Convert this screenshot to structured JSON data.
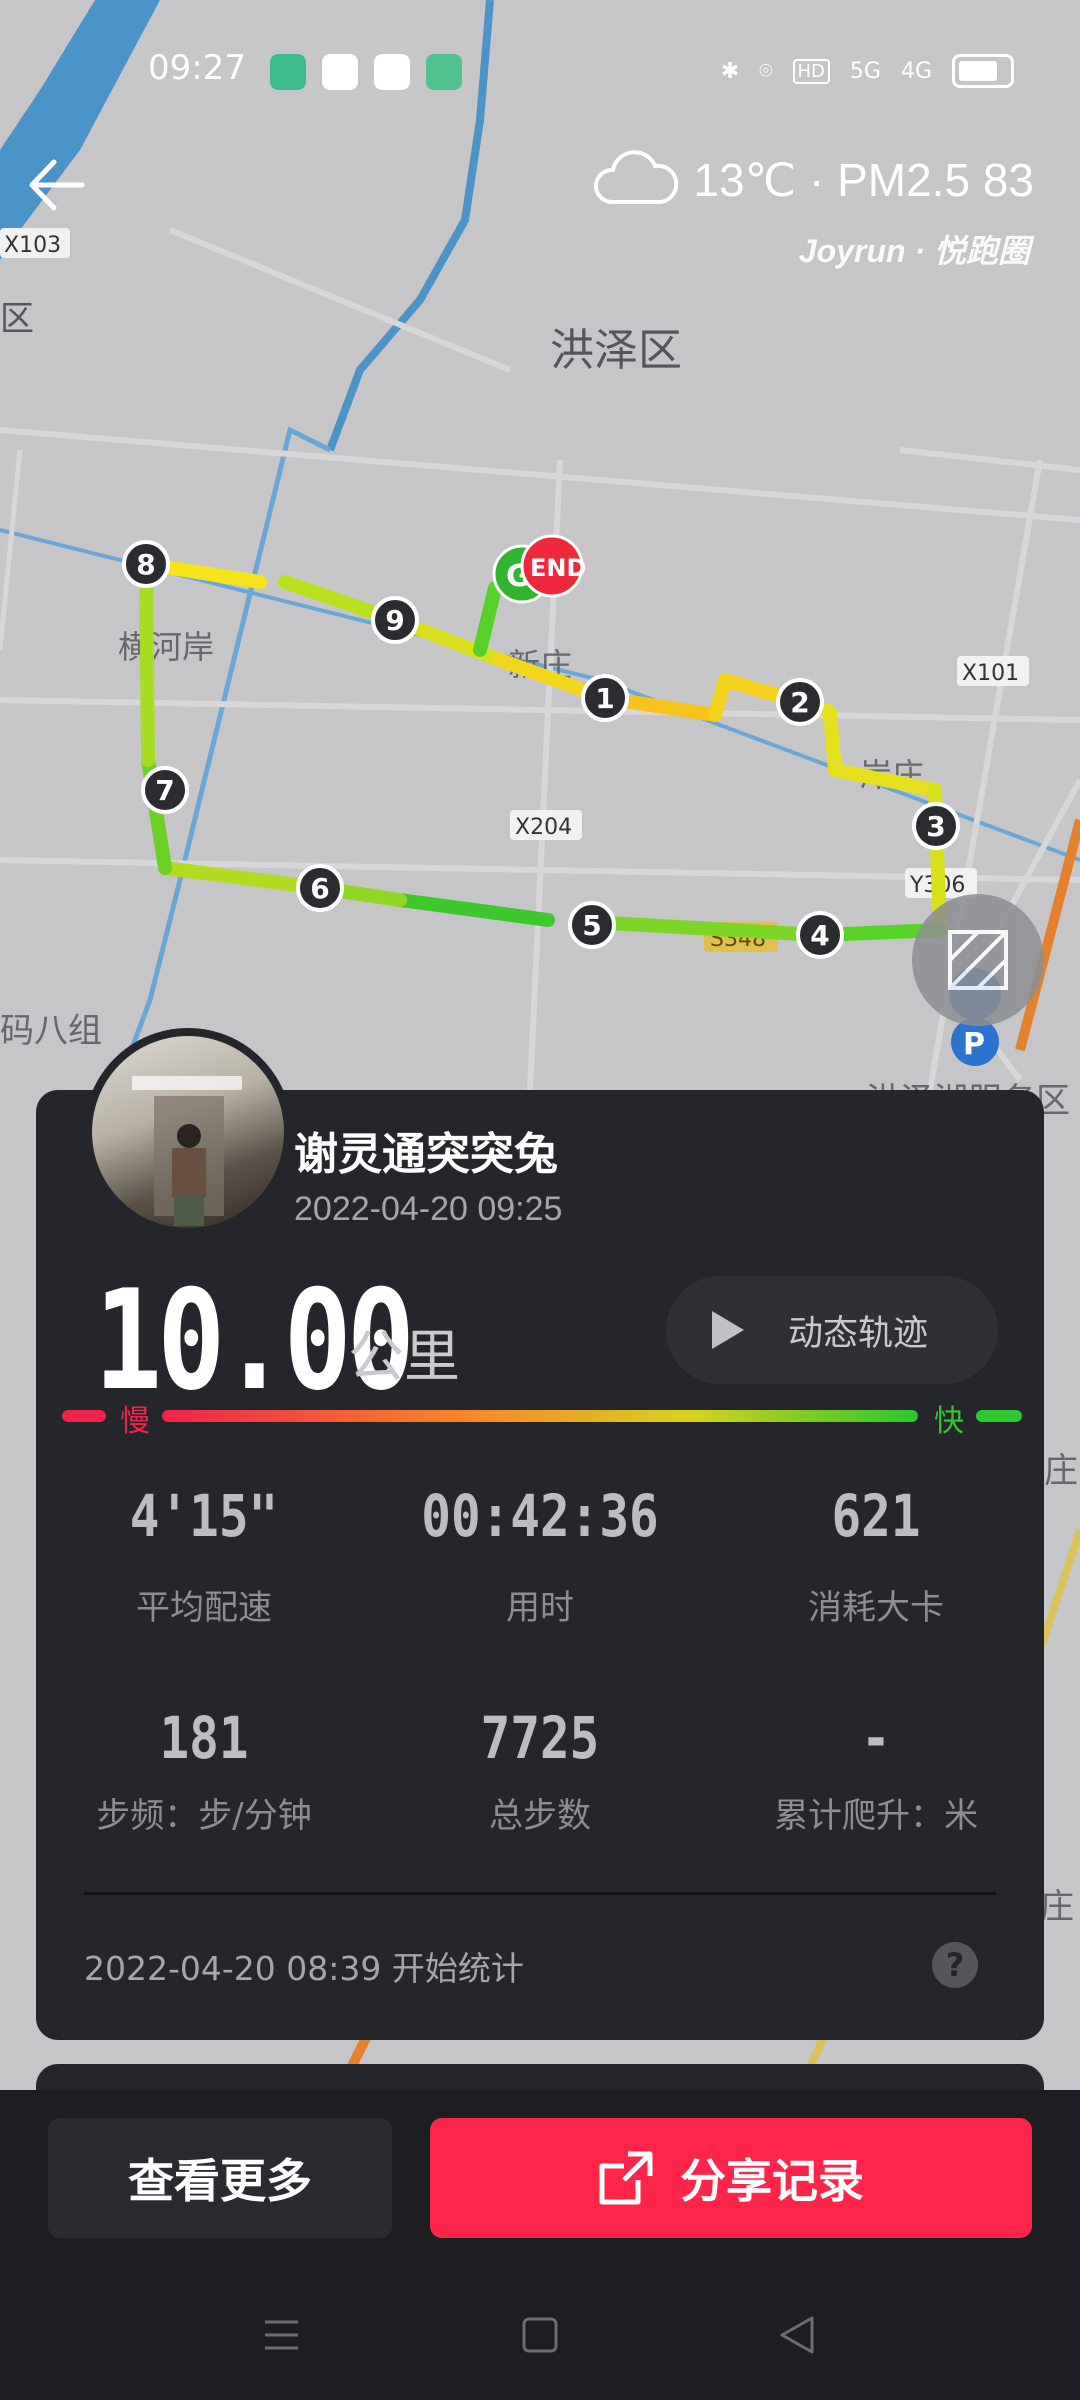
{
  "status_bar": {
    "time": "09:27",
    "network_label": "HD",
    "signal1": "5G",
    "signal2": "4G"
  },
  "weather": {
    "text": "13℃ · PM2.5 83",
    "icon": "cloud-icon"
  },
  "brand": "Joyrun · 悦跑圈",
  "map": {
    "district": "洪泽区",
    "labels": [
      "X103",
      "区",
      "横河岸",
      "新庄",
      "X101",
      "岸庄",
      "X204",
      "Y306",
      "S348",
      "码八组",
      "洪泽湖服务区",
      "庄",
      "庄"
    ],
    "markers": [
      "1",
      "2",
      "3",
      "4",
      "5",
      "6",
      "7",
      "8",
      "9"
    ],
    "start_label": "G",
    "end_label": "END"
  },
  "user": {
    "name": "谢灵通突突兔",
    "datetime": "2022-04-20 09:25"
  },
  "distance": {
    "value": "10.00",
    "unit": "公里"
  },
  "replay_button": "动态轨迹",
  "speed_legend": {
    "slow": "慢",
    "fast": "快"
  },
  "stats": [
    {
      "value": "4'15\"",
      "label": "平均配速"
    },
    {
      "value": "00:42:36",
      "label": "用时"
    },
    {
      "value": "621",
      "label": "消耗大卡"
    },
    {
      "value": "181",
      "label": "步频：步/分钟"
    },
    {
      "value": "7725",
      "label": "总步数"
    },
    {
      "value": "-",
      "label": "累计爬升：米"
    }
  ],
  "footer": {
    "start_text": "2022-04-20 08:39  开始统计",
    "help": "?"
  },
  "actions": {
    "more": "查看更多",
    "share": "分享记录"
  },
  "colors": {
    "accent": "#ff2449",
    "slow": "#f0234b",
    "fast": "#2fc92f",
    "card": "#25262b"
  }
}
